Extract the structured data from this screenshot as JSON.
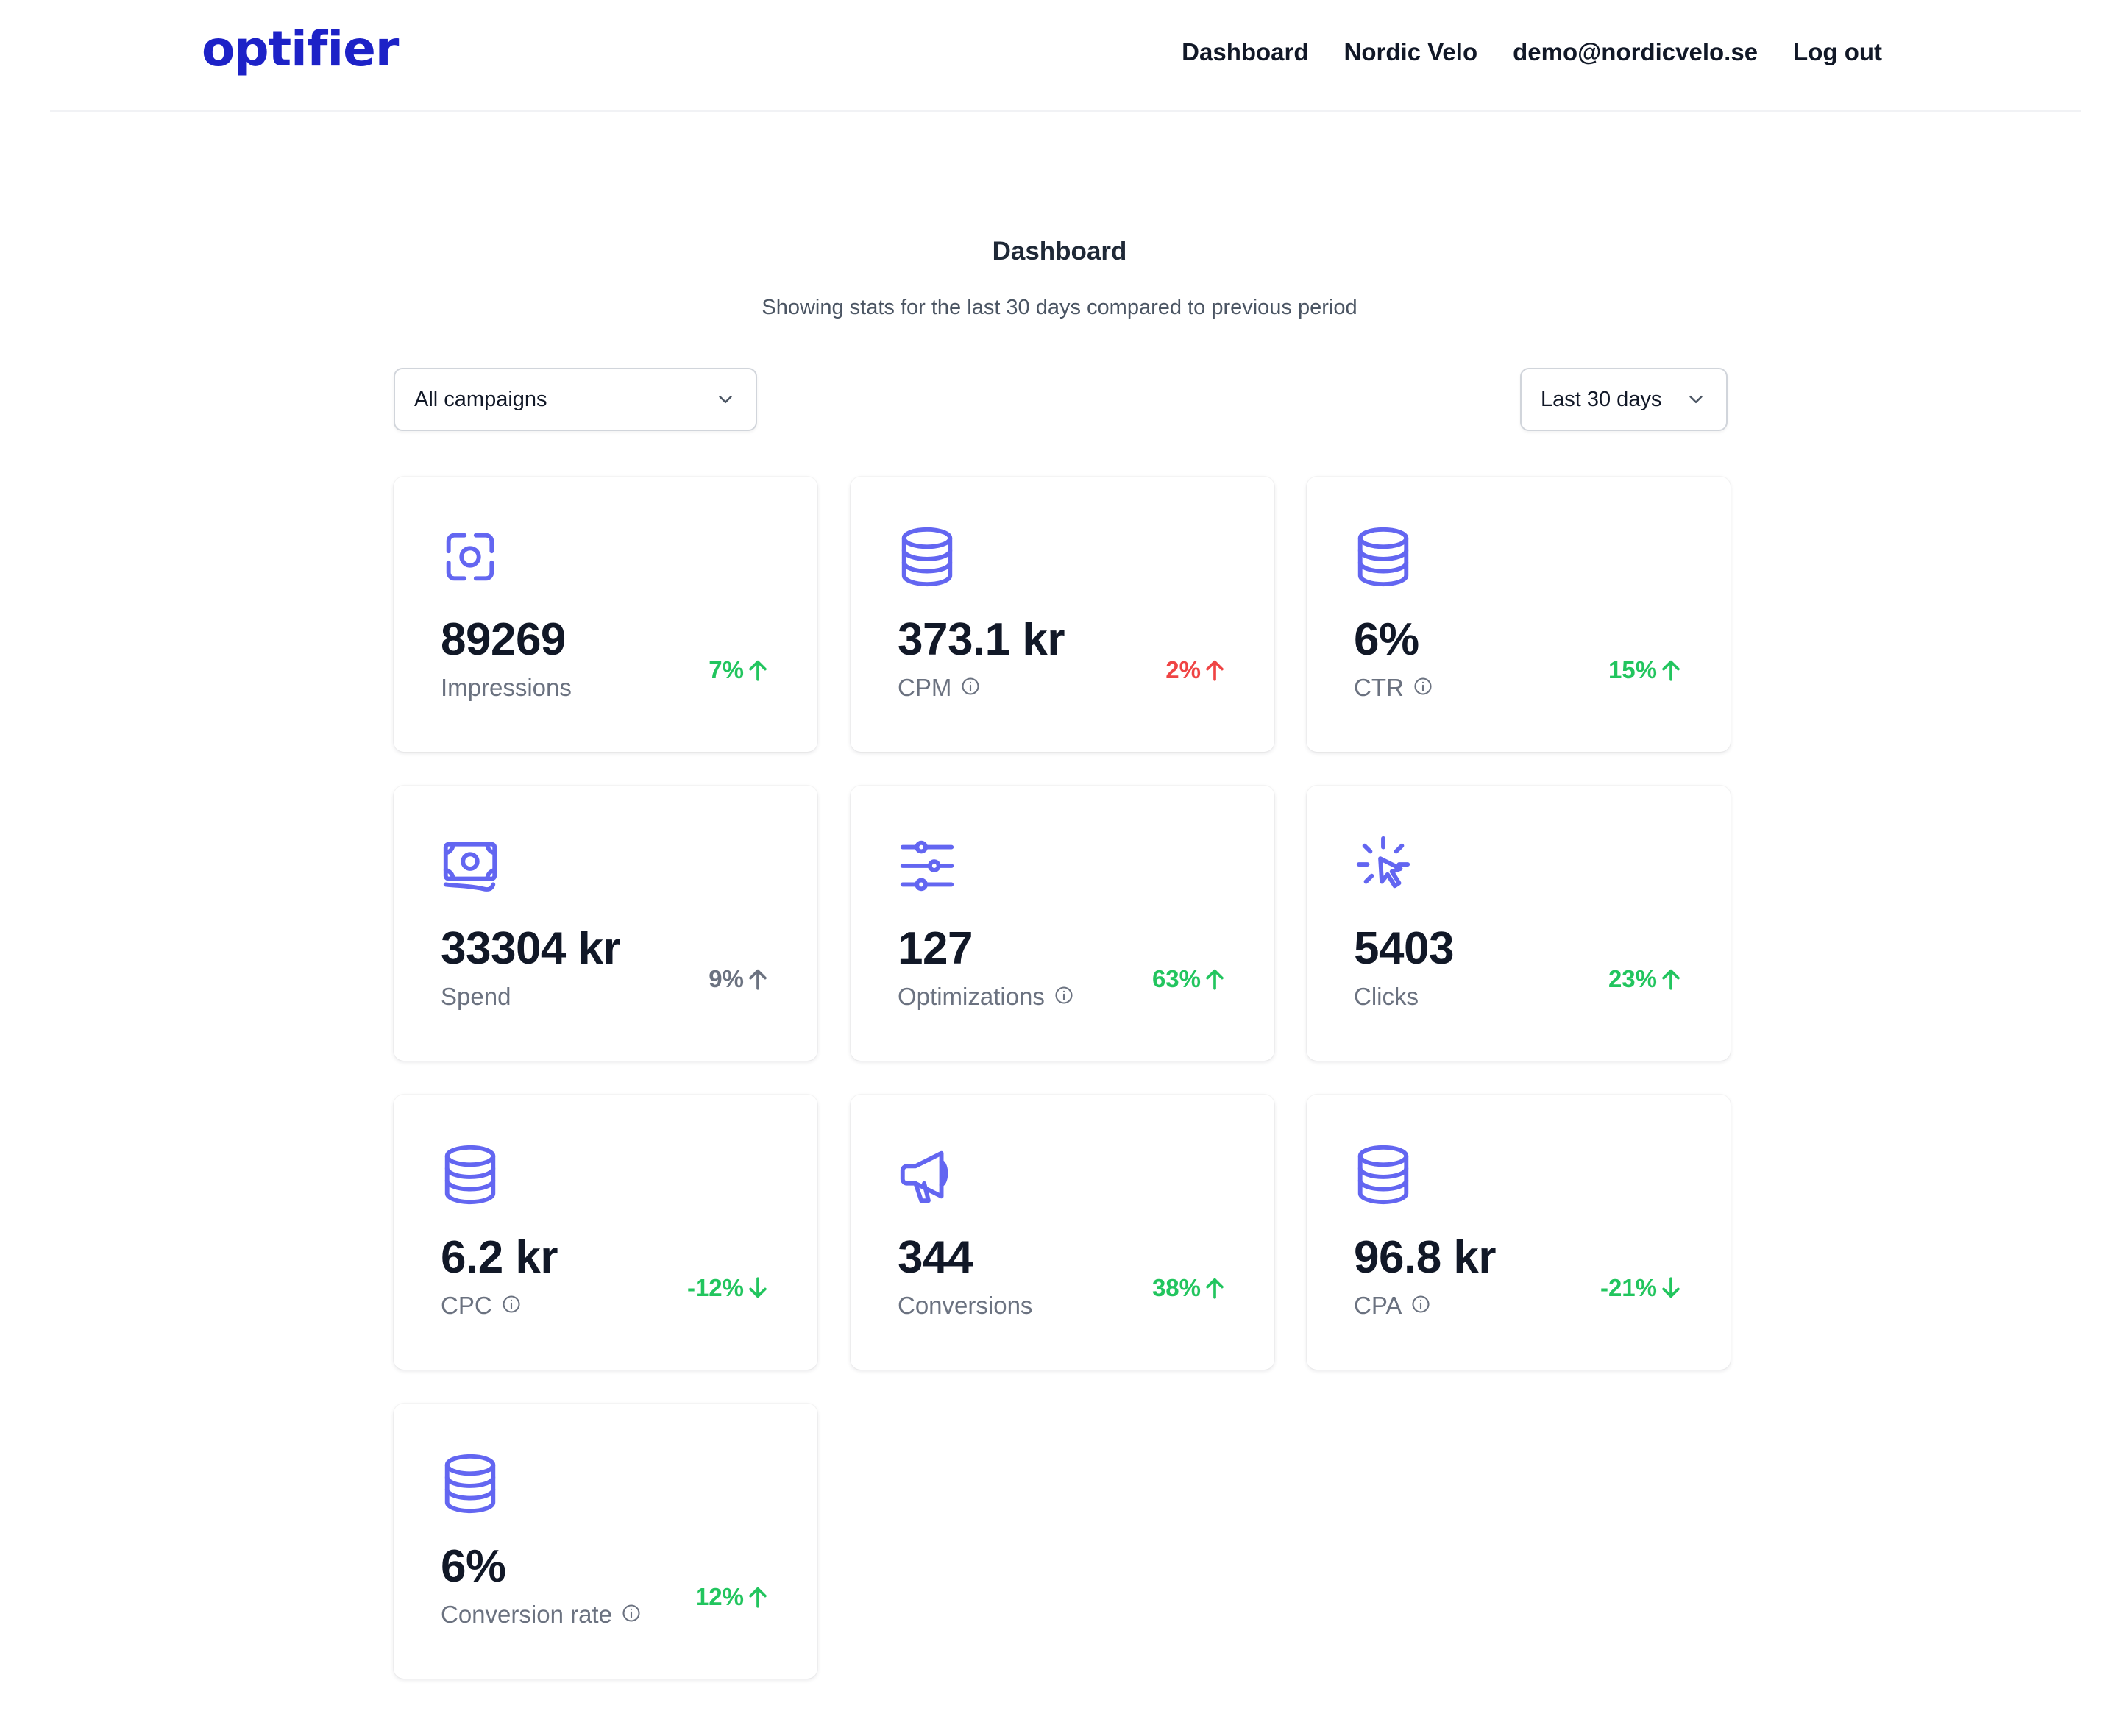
{
  "brand": {
    "logo": "optifier",
    "color": "#1d22c7"
  },
  "nav": {
    "dashboard": "Dashboard",
    "company": "Nordic Velo",
    "email": "demo@nordicvelo.se",
    "logout": "Log out"
  },
  "page": {
    "title": "Dashboard",
    "subtitle": "Showing stats for the last 30 days compared to previous period"
  },
  "filters": {
    "campaign": "All campaigns",
    "period": "Last 30 days"
  },
  "colors": {
    "accent": "#6366f1",
    "positive": "#22c55e",
    "negative": "#ef4444",
    "neutral": "#6b7280"
  },
  "cards": [
    {
      "icon": "focus-icon",
      "value": "89269",
      "label": "Impressions",
      "change": "7%",
      "direction": "up",
      "tone": "green",
      "info": false
    },
    {
      "icon": "coins-icon",
      "value": "373.1 kr",
      "label": "CPM",
      "change": "2%",
      "direction": "up",
      "tone": "red",
      "info": true
    },
    {
      "icon": "coins-icon",
      "value": "6%",
      "label": "CTR",
      "change": "15%",
      "direction": "up",
      "tone": "green",
      "info": true
    },
    {
      "icon": "banknote-icon",
      "value": "33304 kr",
      "label": "Spend",
      "change": "9%",
      "direction": "up",
      "tone": "gray",
      "info": false
    },
    {
      "icon": "sliders-icon",
      "value": "127",
      "label": "Optimizations",
      "change": "63%",
      "direction": "up",
      "tone": "green",
      "info": true
    },
    {
      "icon": "cursor-click-icon",
      "value": "5403",
      "label": "Clicks",
      "change": "23%",
      "direction": "up",
      "tone": "green",
      "info": false
    },
    {
      "icon": "coins-icon",
      "value": "6.2 kr",
      "label": "CPC",
      "change": "-12%",
      "direction": "down",
      "tone": "green",
      "info": true
    },
    {
      "icon": "megaphone-icon",
      "value": "344",
      "label": "Conversions",
      "change": "38%",
      "direction": "up",
      "tone": "green",
      "info": false
    },
    {
      "icon": "coins-icon",
      "value": "96.8 kr",
      "label": "CPA",
      "change": "-21%",
      "direction": "down",
      "tone": "green",
      "info": true
    },
    {
      "icon": "coins-icon",
      "value": "6%",
      "label": "Conversion rate",
      "change": "12%",
      "direction": "up",
      "tone": "green",
      "info": true
    }
  ]
}
